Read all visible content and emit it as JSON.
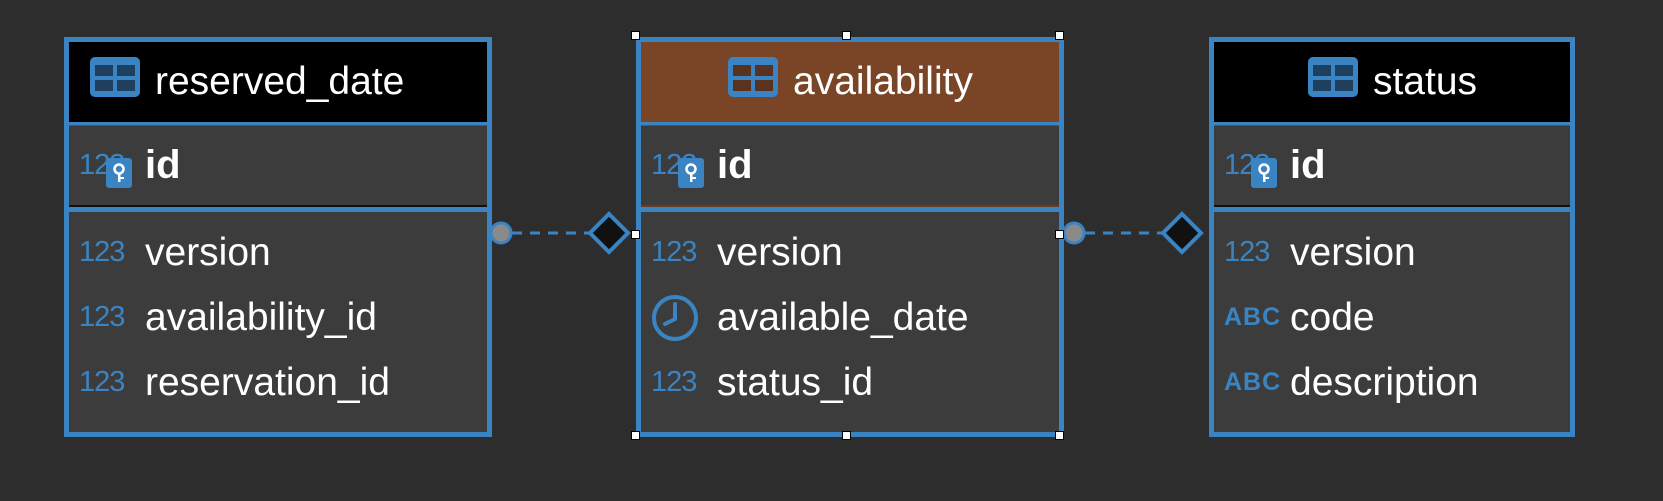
{
  "diagram": {
    "entities": [
      {
        "id": "reserved_date",
        "title": "reserved_date",
        "pk": {
          "type_label": "123",
          "name": "id"
        },
        "attributes": [
          {
            "type_label": "123",
            "name": "version",
            "icon": "numeric-icon"
          },
          {
            "type_label": "123",
            "name": "availability_id",
            "icon": "numeric-icon"
          },
          {
            "type_label": "123",
            "name": "reservation_id",
            "icon": "numeric-icon"
          }
        ]
      },
      {
        "id": "availability",
        "title": "availability",
        "selected": true,
        "header_color": "#7a4426",
        "pk": {
          "type_label": "123",
          "name": "id"
        },
        "attributes": [
          {
            "type_label": "123",
            "name": "version",
            "icon": "numeric-icon"
          },
          {
            "type_label": "",
            "name": "available_date",
            "icon": "clock-icon"
          },
          {
            "type_label": "123",
            "name": "status_id",
            "icon": "numeric-icon"
          }
        ]
      },
      {
        "id": "status",
        "title": "status",
        "pk": {
          "type_label": "123",
          "name": "id"
        },
        "attributes": [
          {
            "type_label": "123",
            "name": "version",
            "icon": "numeric-icon"
          },
          {
            "type_label": "ABC",
            "name": "code",
            "icon": "text-icon"
          },
          {
            "type_label": "ABC",
            "name": "description",
            "icon": "text-icon"
          }
        ]
      }
    ],
    "relationships": [
      {
        "from": "reserved_date",
        "to": "availability"
      },
      {
        "from": "availability",
        "to": "status"
      }
    ],
    "colors": {
      "border": "#3a84c4",
      "background": "#2d2d2d",
      "entity_bg": "#3c3c3c",
      "header": "#000000",
      "selected_header": "#7a4426"
    }
  }
}
